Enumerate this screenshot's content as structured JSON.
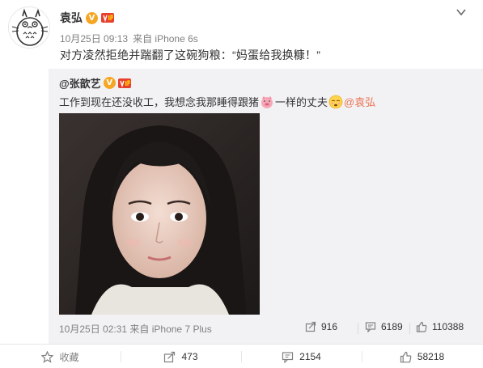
{
  "post": {
    "author": "袁弘",
    "time": "10月25日 09:13",
    "source": "来自 iPhone 6s",
    "text": "对方凌然拒绝并踹翻了这碗狗粮：“妈蛋给我换糠！”",
    "icons": {
      "avatar": "totoro-avatar",
      "verified": "verified-v-badge",
      "vip": "vip-badge",
      "menu": "chevron-down-icon"
    }
  },
  "repost": {
    "author": "@张歆艺",
    "text_before": "工作到现在还没收工，我想念我那睡得跟猪",
    "text_middle": "一样的丈夫",
    "mention": "@袁弘",
    "time": "10月25日 02:31",
    "source": "来自 iPhone 7 Plus",
    "stats": {
      "forwards": "916",
      "comments": "6189",
      "likes": "110388"
    },
    "icons": {
      "pig_emoji": "pig-emoji",
      "sleepy_emoji": "sleepy-face-emoji"
    }
  },
  "actions": {
    "favorite_label": "收藏",
    "forwards": "473",
    "comments": "2154",
    "likes": "58218"
  },
  "colors": {
    "mention": "#eb7350",
    "repost_bg": "#f2f2f5",
    "badge": "#f5a623",
    "vip": "#e8402e"
  }
}
